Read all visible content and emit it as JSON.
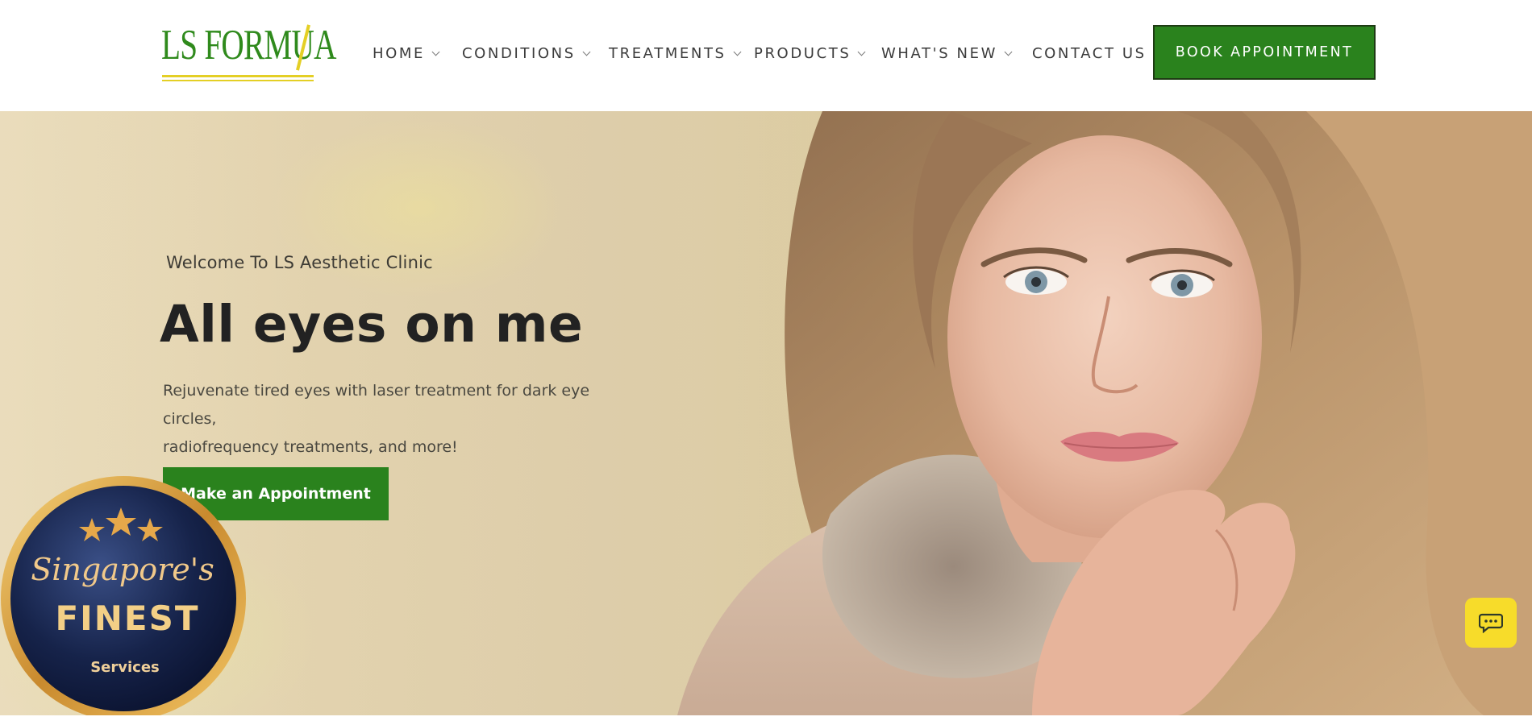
{
  "brand": {
    "logo_text": "LS FORMU",
    "logo_suffix": "A"
  },
  "nav": {
    "items": [
      {
        "label": "HOME",
        "dropdown": true
      },
      {
        "label": "CONDITIONS",
        "dropdown": true
      },
      {
        "label": "TREATMENTS",
        "dropdown": true
      },
      {
        "label": "PRODUCTS",
        "dropdown": true
      },
      {
        "label": "WHAT'S NEW",
        "dropdown": true
      },
      {
        "label": "CONTACT US",
        "dropdown": false
      }
    ],
    "book_label": "BOOK APPOINTMENT"
  },
  "hero": {
    "welcome": "Welcome To LS Aesthetic Clinic",
    "headline": "All eyes on me",
    "subtext_line1": "Rejuvenate tired eyes with laser treatment for dark eye circles,",
    "subtext_line2": "radiofrequency treatments, and more!",
    "cta_label": "Make an Appointment"
  },
  "badge": {
    "line1": "Singapore's",
    "line2": "FINEST",
    "line3": "Services",
    "stars": 3
  },
  "chat": {
    "icon": "chat-icon"
  },
  "colors": {
    "brand_green": "#2a821d",
    "logo_green": "#2f8a1c",
    "accent_yellow": "#e4cf25",
    "chat_yellow": "#f7dc2a",
    "badge_navy": "#0f1a3a",
    "badge_gold": "#d9a441"
  }
}
